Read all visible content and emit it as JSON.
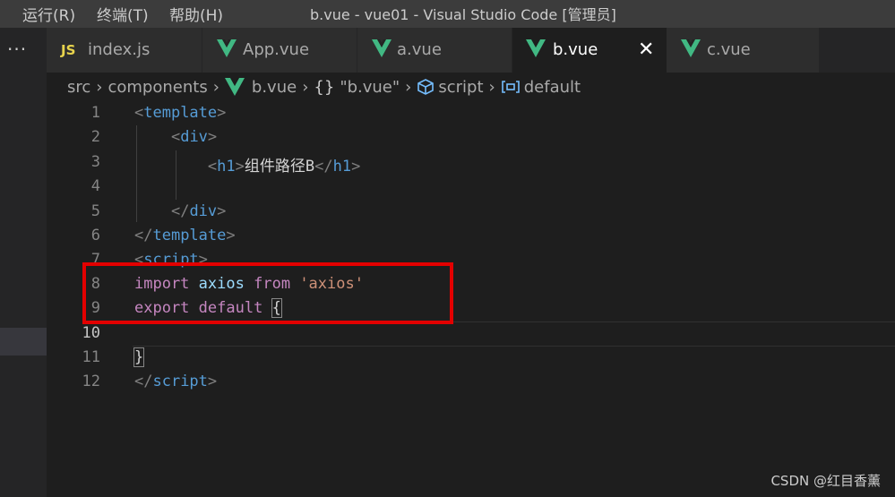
{
  "titlebar": {
    "menu_run": "运行(R)",
    "menu_terminal": "终端(T)",
    "menu_help": "帮助(H)",
    "window_title": "b.vue - vue01 - Visual Studio Code [管理员]"
  },
  "activity": {
    "more": "···"
  },
  "tabs": [
    {
      "label": "index.js",
      "icon": "JS"
    },
    {
      "label": "App.vue",
      "icon": "V"
    },
    {
      "label": "a.vue",
      "icon": "V"
    },
    {
      "label": "b.vue",
      "icon": "V",
      "close": "✕"
    },
    {
      "label": "c.vue",
      "icon": "V"
    }
  ],
  "breadcrumb": {
    "src": "src",
    "components": "components",
    "file": "b.vue",
    "obj_icon": "{}",
    "obj": "\"b.vue\"",
    "script": "script",
    "default": "default",
    "sep": "›"
  },
  "code": {
    "line_numbers": [
      "1",
      "2",
      "3",
      "4",
      "5",
      "6",
      "7",
      "8",
      "9",
      "10",
      "11",
      "12"
    ],
    "template_tag": "template",
    "div_tag": "div",
    "h1_tag": "h1",
    "h1_text": "组件路径B",
    "script_tag": "script",
    "kw_import": "import",
    "id_axios": "axios",
    "kw_from": "from",
    "str_axios": "'axios'",
    "kw_export": "export",
    "kw_default": "default",
    "brace_open": "{",
    "brace_close": "}"
  },
  "watermark": "CSDN @红目香薰",
  "colors": {
    "vue_icon": "#41b883",
    "highlight_box": "#e30000"
  }
}
